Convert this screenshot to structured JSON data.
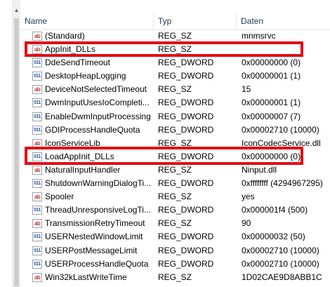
{
  "columns": {
    "name": "Name",
    "type": "Typ",
    "data": "Daten"
  },
  "colors": {
    "highlight": "#e30b13",
    "header_text": "#1e395b",
    "string_icon": "#c0392b",
    "dword_icon": "#2a5aa8"
  },
  "icons": {
    "reg_sz": "ab",
    "reg_dword": "011"
  },
  "scrollbar": {
    "up_arrow": "▲"
  },
  "rows": [
    {
      "name": "(Standard)",
      "type": "REG_SZ",
      "data": "mnmsrvc",
      "icon": "sz"
    },
    {
      "name": "AppInit_DLLs",
      "type": "REG_SZ",
      "data": "",
      "icon": "sz",
      "highlighted": true
    },
    {
      "name": "DdeSendTimeout",
      "type": "REG_DWORD",
      "data": "0x00000000 (0)",
      "icon": "dw"
    },
    {
      "name": "DesktopHeapLogging",
      "type": "REG_DWORD",
      "data": "0x00000001 (1)",
      "icon": "dw"
    },
    {
      "name": "DeviceNotSelectedTimeout",
      "type": "REG_SZ",
      "data": "15",
      "icon": "sz"
    },
    {
      "name": "DwmInputUsesIoCompleti...",
      "type": "REG_DWORD",
      "data": "0x00000001 (1)",
      "icon": "dw"
    },
    {
      "name": "EnableDwmInputProcessing",
      "type": "REG_DWORD",
      "data": "0x00000007 (7)",
      "icon": "dw"
    },
    {
      "name": "GDIProcessHandleQuota",
      "type": "REG_DWORD",
      "data": "0x00002710 (10000)",
      "icon": "dw"
    },
    {
      "name": "IconServiceLib",
      "type": "REG_SZ",
      "data": "IconCodecService.dll",
      "icon": "sz"
    },
    {
      "name": "LoadAppInit_DLLs",
      "type": "REG_DWORD",
      "data": "0x00000000 (0)",
      "icon": "dw",
      "highlighted": true
    },
    {
      "name": "NaturalInputHandler",
      "type": "REG_SZ",
      "data": "Ninput.dll",
      "icon": "sz"
    },
    {
      "name": "ShutdownWarningDialogTi...",
      "type": "REG_DWORD",
      "data": "0xffffffff (4294967295)",
      "icon": "dw"
    },
    {
      "name": "Spooler",
      "type": "REG_SZ",
      "data": "yes",
      "icon": "sz"
    },
    {
      "name": "ThreadUnresponsiveLogTi...",
      "type": "REG_DWORD",
      "data": "0x000001f4 (500)",
      "icon": "dw"
    },
    {
      "name": "TransmissionRetryTimeout",
      "type": "REG_SZ",
      "data": "90",
      "icon": "sz"
    },
    {
      "name": "USERNestedWindowLimit",
      "type": "REG_DWORD",
      "data": "0x00000032 (50)",
      "icon": "dw"
    },
    {
      "name": "USERPostMessageLimit",
      "type": "REG_DWORD",
      "data": "0x00002710 (10000)",
      "icon": "dw"
    },
    {
      "name": "USERProcessHandleQuota",
      "type": "REG_DWORD",
      "data": "0x00002710 (10000)",
      "icon": "dw"
    },
    {
      "name": "Win32kLastWriteTime",
      "type": "REG_SZ",
      "data": "1D02CAE9D8ABB1C",
      "icon": "sz"
    }
  ]
}
